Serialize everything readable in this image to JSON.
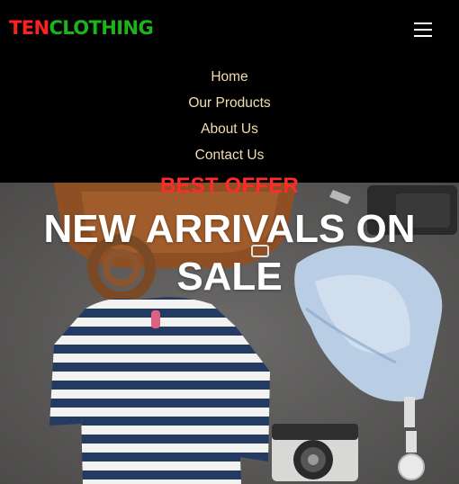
{
  "brand": {
    "part1": "TEN",
    "part2": "CLOTHING",
    "color1": "#ff2020",
    "color2": "#1db31d"
  },
  "nav": {
    "toggle_icon": "hamburger-icon",
    "items": [
      {
        "label": "Home"
      },
      {
        "label": "Our Products"
      },
      {
        "label": "About Us"
      },
      {
        "label": "Contact Us"
      }
    ],
    "link_color": "#f2deb0"
  },
  "hero": {
    "tagline": "BEST OFFER",
    "headline": "NEW ARRIVALS ON SALE",
    "tagline_color": "#ff2a2a",
    "background": "flat-lay-clothing-photo"
  }
}
